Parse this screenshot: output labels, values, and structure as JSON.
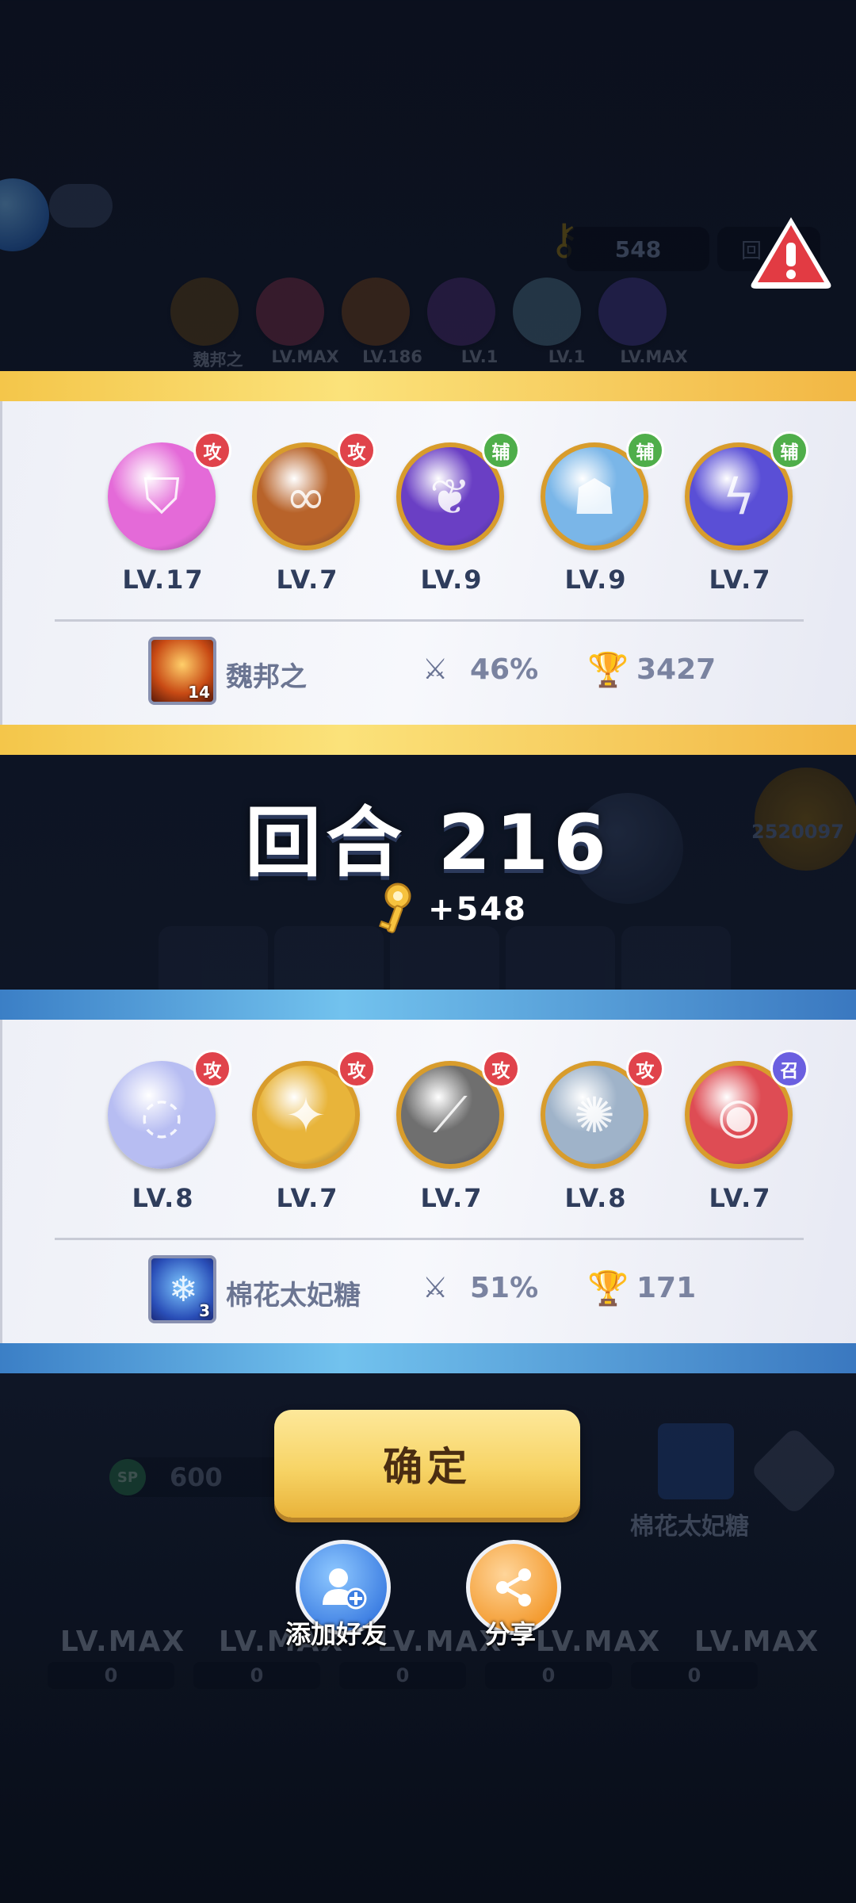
{
  "background": {
    "key_count": "548",
    "top_row_labels": [
      "魏邦之",
      "LV.MAX",
      "LV.186",
      "LV.1",
      "LV.1",
      "LV.MAX"
    ],
    "mid_score": "2520097",
    "sp_label": "SP",
    "sp_value": "600",
    "player2_name": "棉花太妃糖",
    "bottom_levels": [
      "LV.MAX",
      "LV.MAX",
      "LV.MAX",
      "LV.MAX",
      "LV.MAX"
    ],
    "bottom_sp_values": [
      "0",
      "0",
      "0",
      "0",
      "0"
    ]
  },
  "player1": {
    "skills": [
      {
        "badge": "攻",
        "badge_type": "attack",
        "level": "LV.17",
        "color": "#e46ad8",
        "glyph": "shield"
      },
      {
        "badge": "攻",
        "badge_type": "attack",
        "level": "LV.7",
        "color": "#b8632a",
        "glyph": "infinity"
      },
      {
        "badge": "辅",
        "badge_type": "support",
        "level": "LV.9",
        "color": "#6a3fc4",
        "glyph": "sprout"
      },
      {
        "badge": "辅",
        "badge_type": "support",
        "level": "LV.9",
        "color": "#7ab6e8",
        "glyph": "figures"
      },
      {
        "badge": "辅",
        "badge_type": "support",
        "level": "LV.7",
        "color": "#5a4fd6",
        "glyph": "lightning"
      }
    ],
    "avatar_level": "14",
    "name": "魏邦之",
    "win_rate": "46%",
    "trophies": "3427"
  },
  "round": {
    "label": "回合 216",
    "reward": "+548"
  },
  "player2": {
    "skills": [
      {
        "badge": "攻",
        "badge_type": "attack",
        "level": "LV.8",
        "color": "#b7bdf2",
        "glyph": "bubbles"
      },
      {
        "badge": "攻",
        "badge_type": "attack",
        "level": "LV.7",
        "color": "#e8b43a",
        "glyph": "shuriken"
      },
      {
        "badge": "攻",
        "badge_type": "attack",
        "level": "LV.7",
        "color": "#6f6f6f",
        "glyph": "scythe"
      },
      {
        "badge": "攻",
        "badge_type": "attack",
        "level": "LV.8",
        "color": "#9fb3c9",
        "glyph": "fan"
      },
      {
        "badge": "召",
        "badge_type": "summon",
        "level": "LV.7",
        "color": "#de4c54",
        "glyph": "cannon"
      }
    ],
    "avatar_level": "3",
    "name": "棉花太妃糖",
    "win_rate": "51%",
    "trophies": "171"
  },
  "buttons": {
    "confirm": "确定",
    "add_friend": "添加好友",
    "share": "分享"
  },
  "colors": {
    "badge_attack": "#e0434b",
    "badge_support": "#4fae4a",
    "badge_summon": "#6b5fe0",
    "gold_band": "#f4c64a",
    "blue_band": "#5aa6df"
  }
}
